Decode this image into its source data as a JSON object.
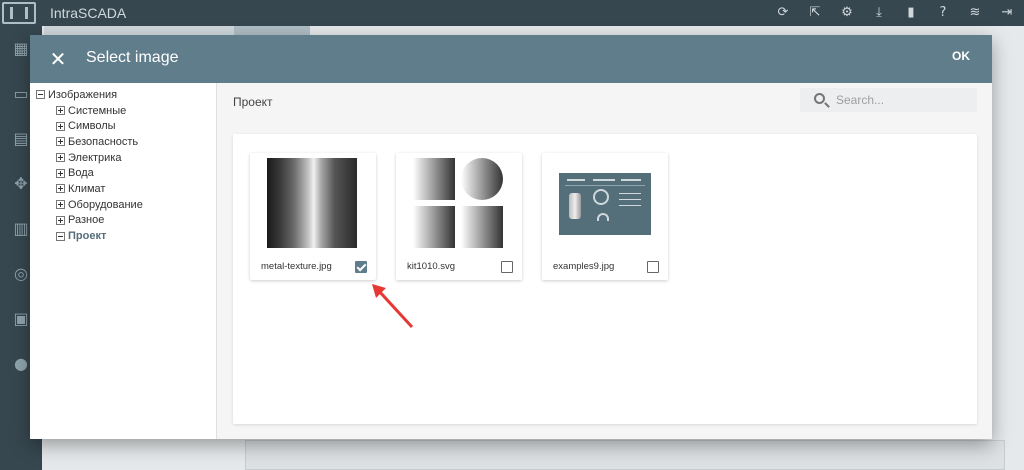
{
  "app": {
    "title": "IntraSCADA",
    "toolbar_icons": [
      "refresh-icon",
      "export-icon",
      "gear-icon",
      "download-icon",
      "device-icon",
      "help-icon",
      "wifi-icon",
      "logout-icon"
    ],
    "sidebar_icons": [
      "cpu-icon",
      "monitor-icon",
      "document-icon",
      "puzzle-icon",
      "chart-icon",
      "database-icon",
      "printer-icon",
      "user-icon"
    ]
  },
  "dialog": {
    "title": "Select image",
    "ok_label": "OK",
    "close_glyph": "✕",
    "accent_color": "#607d8b"
  },
  "tree": {
    "root": {
      "label": "Изображения",
      "expanded": true
    },
    "items": [
      {
        "label": "Системные",
        "expanded": false
      },
      {
        "label": "Символы",
        "expanded": false
      },
      {
        "label": "Безопасность",
        "expanded": false
      },
      {
        "label": "Электрика",
        "expanded": false
      },
      {
        "label": "Вода",
        "expanded": false
      },
      {
        "label": "Климат",
        "expanded": false
      },
      {
        "label": "Оборудование",
        "expanded": false
      },
      {
        "label": "Разное",
        "expanded": false
      },
      {
        "label": "Проект",
        "expanded": true,
        "selected": true
      }
    ]
  },
  "main": {
    "path": "Проект",
    "search": {
      "placeholder": "Search...",
      "value": ""
    }
  },
  "images": [
    {
      "name": "metal-texture.jpg",
      "checked": true
    },
    {
      "name": "kit1010.svg",
      "checked": false
    },
    {
      "name": "examples9.jpg",
      "checked": false
    }
  ]
}
